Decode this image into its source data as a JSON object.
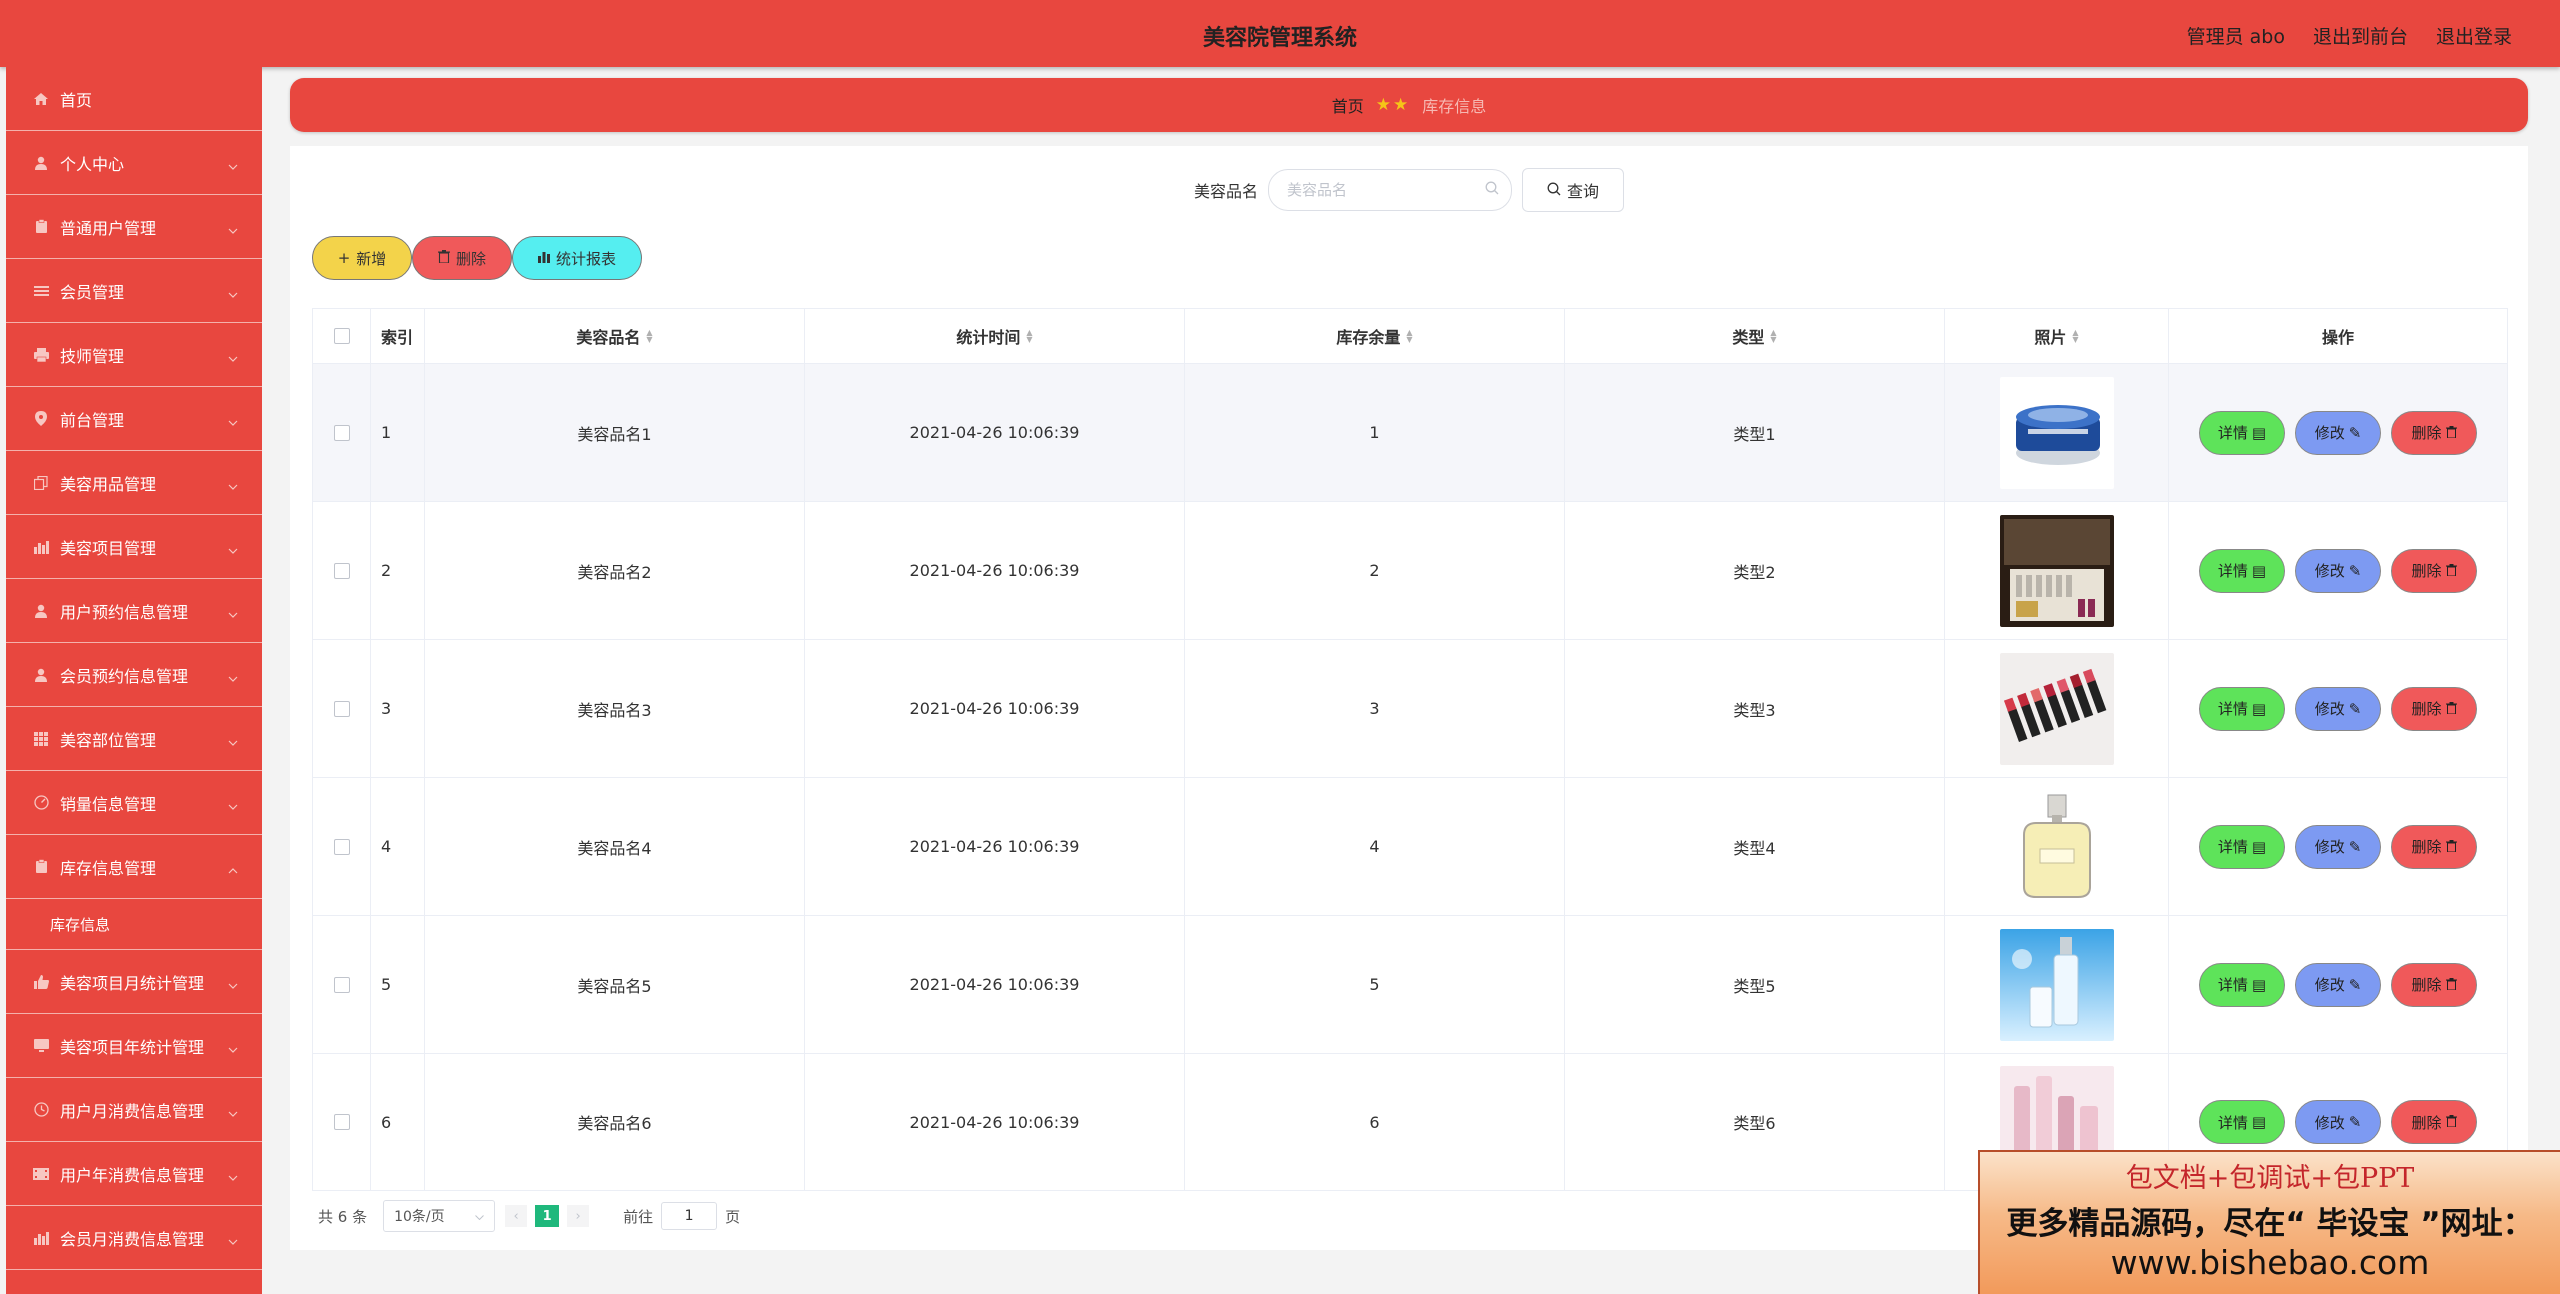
{
  "app": {
    "title": "美容院管理系统",
    "admin_label": "管理员 abo",
    "exit_front": "退出到前台",
    "logout": "退出登录"
  },
  "sidebar": {
    "items": [
      {
        "label": "首页",
        "icon": "home-icon"
      },
      {
        "label": "个人中心",
        "icon": "user-icon"
      },
      {
        "label": "普通用户管理",
        "icon": "clipboard-icon"
      },
      {
        "label": "会员管理",
        "icon": "list-icon"
      },
      {
        "label": "技师管理",
        "icon": "printer-icon"
      },
      {
        "label": "前台管理",
        "icon": "location-icon"
      },
      {
        "label": "美容用品管理",
        "icon": "copy-icon"
      },
      {
        "label": "美容项目管理",
        "icon": "chart-icon"
      },
      {
        "label": "用户预约信息管理",
        "icon": "user-icon"
      },
      {
        "label": "会员预约信息管理",
        "icon": "user-icon"
      },
      {
        "label": "美容部位管理",
        "icon": "grid-icon"
      },
      {
        "label": "销量信息管理",
        "icon": "gauge-icon"
      },
      {
        "label": "库存信息管理",
        "icon": "clipboard-icon"
      },
      {
        "label": "美容项目月统计管理",
        "icon": "thumb-icon"
      },
      {
        "label": "美容项目年统计管理",
        "icon": "monitor-icon"
      },
      {
        "label": "用户月消费信息管理",
        "icon": "clock-icon"
      },
      {
        "label": "用户年消费信息管理",
        "icon": "film-icon"
      },
      {
        "label": "会员月消费信息管理",
        "icon": "chart-icon"
      }
    ],
    "sub_item": "库存信息"
  },
  "breadcrumb": {
    "home": "首页",
    "stars": "★★",
    "current": "库存信息"
  },
  "search": {
    "label": "美容品名",
    "placeholder": "美容品名",
    "button": "查询"
  },
  "actions": {
    "add": "新增",
    "delete": "删除",
    "report": "统计报表"
  },
  "table": {
    "headers": {
      "index": "索引",
      "name": "美容品名",
      "time": "统计时间",
      "stock": "库存余量",
      "type": "类型",
      "photo": "照片",
      "ops": "操作"
    },
    "rows": [
      {
        "index": "1",
        "name": "美容品名1",
        "time": "2021-04-26 10:06:39",
        "stock": "1",
        "type": "类型1"
      },
      {
        "index": "2",
        "name": "美容品名2",
        "time": "2021-04-26 10:06:39",
        "stock": "2",
        "type": "类型2"
      },
      {
        "index": "3",
        "name": "美容品名3",
        "time": "2021-04-26 10:06:39",
        "stock": "3",
        "type": "类型3"
      },
      {
        "index": "4",
        "name": "美容品名4",
        "time": "2021-04-26 10:06:39",
        "stock": "4",
        "type": "类型4"
      },
      {
        "index": "5",
        "name": "美容品名5",
        "time": "2021-04-26 10:06:39",
        "stock": "5",
        "type": "类型5"
      },
      {
        "index": "6",
        "name": "美容品名6",
        "time": "2021-04-26 10:06:39",
        "stock": "6",
        "type": "类型6"
      }
    ],
    "op_labels": {
      "detail": "详情",
      "edit": "修改",
      "delete": "删除"
    }
  },
  "pager": {
    "total": "共 6 条",
    "page_size": "10条/页",
    "current_page": "1",
    "goto_label": "前往",
    "goto_value": "1",
    "page_unit": "页"
  },
  "ad": {
    "line1": "包文档+包调试+包PPT",
    "line2": "更多精品源码，尽在“ 毕设宝 ”网址：",
    "line3": "www.bishebao.com"
  }
}
